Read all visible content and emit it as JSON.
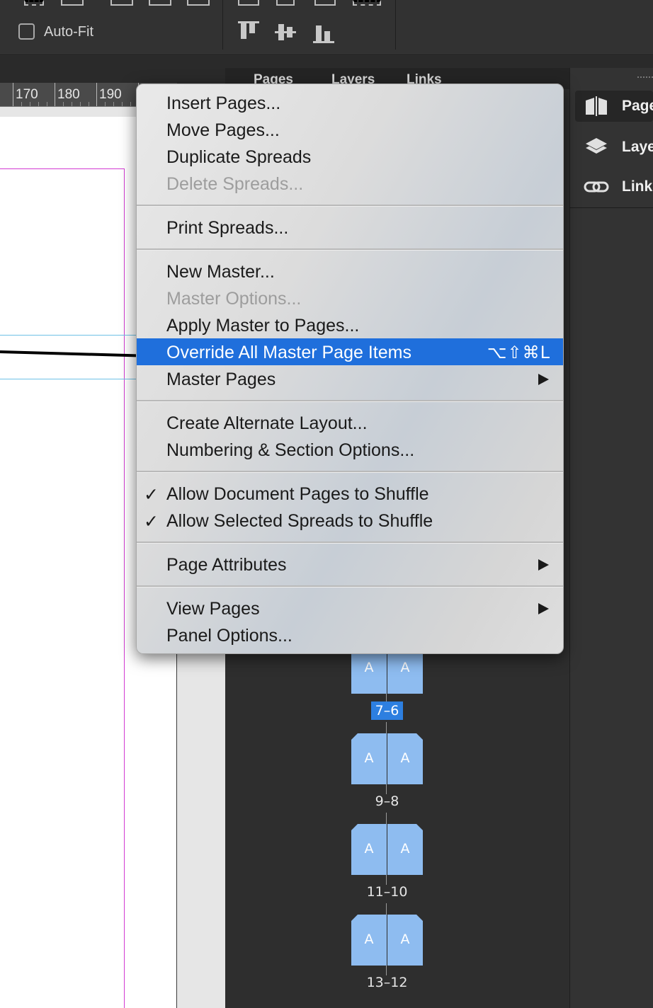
{
  "toolbar": {
    "autofit_label": "Auto-Fit",
    "autofit_checked": false,
    "align_icons": [
      "align-top-edges-icon",
      "align-vertical-centers-icon",
      "align-bottom-edges-icon"
    ]
  },
  "ruler": {
    "labels": [
      "170",
      "180",
      "190"
    ]
  },
  "pages_panel": {
    "tabs": [
      "Pages",
      "Layers",
      "Links"
    ],
    "spreads": [
      {
        "left": "A",
        "right": "A",
        "label": "7–6",
        "selected": true
      },
      {
        "left": "A",
        "right": "A",
        "label": "9–8",
        "selected": false
      },
      {
        "left": "A",
        "right": "A",
        "label": "11–10",
        "selected": false
      },
      {
        "left": "A",
        "right": "A",
        "label": "13–12",
        "selected": false
      }
    ]
  },
  "dock": {
    "items": [
      {
        "label": "Pages",
        "icon": "pages-icon",
        "active": true
      },
      {
        "label": "Layers",
        "icon": "layers-icon",
        "active": false
      },
      {
        "label": "Links",
        "icon": "links-icon",
        "active": false
      }
    ]
  },
  "menu": {
    "items": {
      "insert_pages": "Insert Pages...",
      "move_pages": "Move Pages...",
      "duplicate_spreads": "Duplicate Spreads",
      "delete_spreads": "Delete Spreads...",
      "print_spreads": "Print Spreads...",
      "new_master": "New Master...",
      "master_options": "Master Options...",
      "apply_master": "Apply Master to Pages...",
      "override_all": "Override All Master Page Items",
      "override_shortcut": "⌥⇧⌘L",
      "master_pages": "Master Pages",
      "create_alternate": "Create Alternate Layout...",
      "numbering": "Numbering & Section Options...",
      "allow_doc_shuffle": "Allow Document Pages to Shuffle",
      "allow_sel_shuffle": "Allow Selected Spreads to Shuffle",
      "page_attributes": "Page Attributes",
      "view_pages": "View Pages",
      "panel_options": "Panel Options..."
    },
    "check_glyph": "✓",
    "highlight_color": "#1f6fdc"
  }
}
